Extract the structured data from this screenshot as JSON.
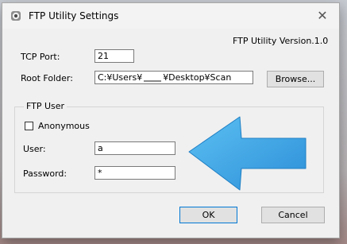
{
  "window": {
    "title": "FTP Utility Settings",
    "version": "FTP Utility Version.1.0"
  },
  "tcp_port": {
    "label": "TCP Port:",
    "value": "21"
  },
  "root_folder": {
    "label": "Root Folder:",
    "value_prefix": "C:¥Users¥",
    "value_suffix": "¥Desktop¥Scan",
    "browse_label": "Browse..."
  },
  "ftp_user": {
    "group_label": "FTP User",
    "anonymous_label": "Anonymous",
    "anonymous_checked": false,
    "user_label": "User:",
    "user_value": "a",
    "password_label": "Password:",
    "password_value": "*"
  },
  "buttons": {
    "ok": "OK",
    "cancel": "Cancel"
  },
  "colors": {
    "arrow": "#3aa2e6",
    "arrow_edge": "#1f7fc4"
  }
}
